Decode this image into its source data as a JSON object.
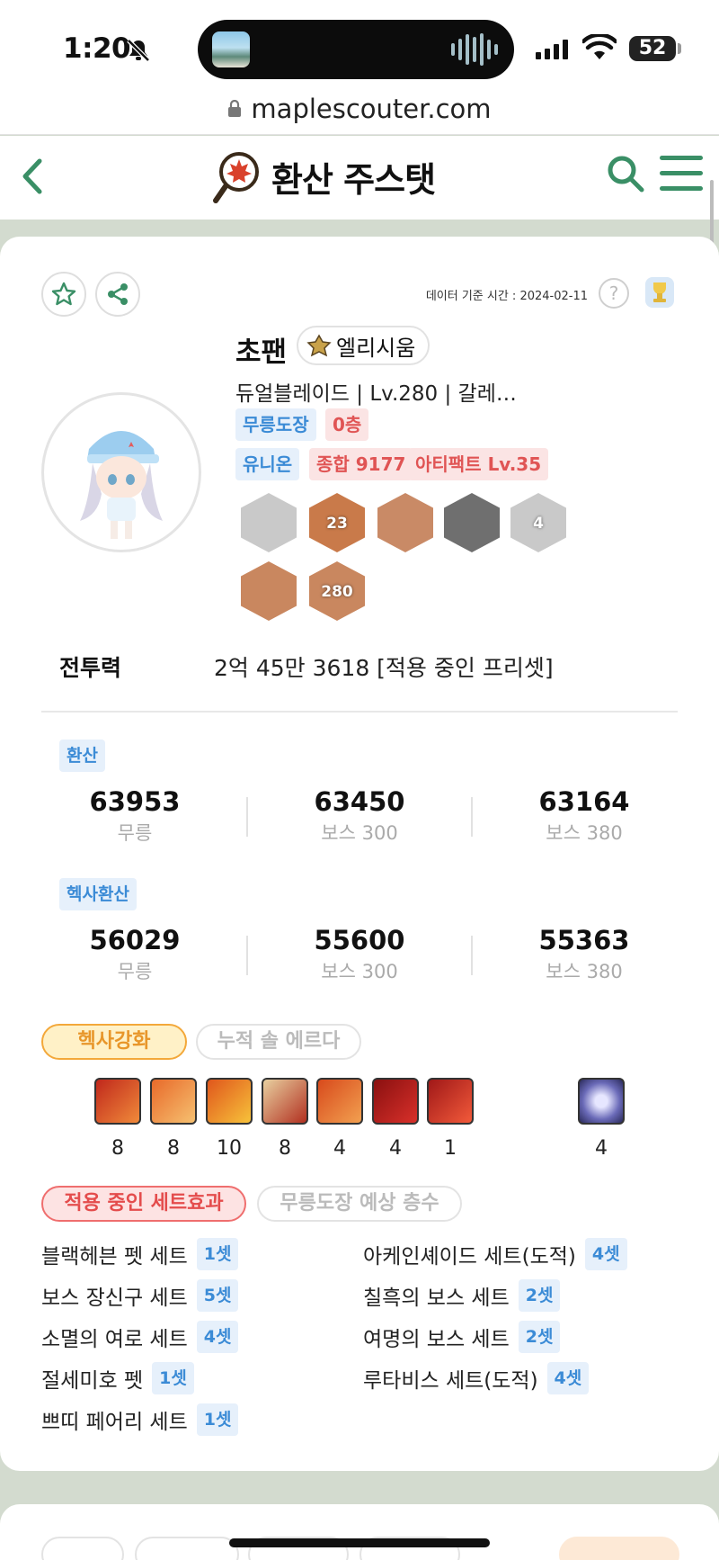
{
  "status_bar": {
    "time": "1:20",
    "battery": "52"
  },
  "browser": {
    "url": "maplescouter.com"
  },
  "nav": {
    "title": "환산 주스탯"
  },
  "profile": {
    "data_time": "데이터 기준 시간 : 2024-02-11",
    "help": "?",
    "name": "초팬",
    "server": "엘리시움",
    "sub_info": "듀얼블레이드 | Lv.280 | 갈레…",
    "tags_row1": [
      "무릉도장",
      "0층"
    ],
    "tags_row2": [
      "유니온",
      "종합 9177",
      "아티팩트 Lv.35"
    ],
    "badges": [
      {
        "name": "trophy-badge",
        "text": "",
        "color": "#c9c9c9"
      },
      {
        "name": "star-23-badge",
        "text": "23",
        "color": "#c97a4a"
      },
      {
        "name": "swords-badge",
        "text": "",
        "color": "#c98a66"
      },
      {
        "name": "skull-badge",
        "text": "",
        "color": "#6f6f6f"
      },
      {
        "name": "witch-hat-4-badge",
        "text": "4",
        "color": "#c9c9c9"
      },
      {
        "name": "hand-badge",
        "text": "",
        "color": "#c9875f"
      },
      {
        "name": "level-280-badge",
        "text": "280",
        "color": "#c9875f"
      }
    ]
  },
  "combat_power": {
    "label": "전투력",
    "value": "2억 45만 3618   [적용 중인 프리셋]"
  },
  "hwansan": {
    "label": "환산",
    "stats": [
      {
        "value": "63953",
        "label": "무릉"
      },
      {
        "value": "63450",
        "label": "보스 300"
      },
      {
        "value": "63164",
        "label": "보스 380"
      }
    ]
  },
  "hexa_hwansan": {
    "label": "헥사환산",
    "stats": [
      {
        "value": "56029",
        "label": "무릉"
      },
      {
        "value": "55600",
        "label": "보스 300"
      },
      {
        "value": "55363",
        "label": "보스 380"
      }
    ]
  },
  "hexa_tabs": {
    "active": "헥사강화",
    "inactive": "누적 솔 에르다"
  },
  "skills": {
    "levels": [
      "8",
      "8",
      "10",
      "8",
      "4",
      "4",
      "1"
    ],
    "extra_level": "4"
  },
  "set_tabs": {
    "active": "적용 중인 세트효과",
    "inactive": "무릉도장 예상 층수"
  },
  "sets_left": [
    {
      "name": "블랙헤븐 펫 세트",
      "count": "1셋"
    },
    {
      "name": "보스 장신구 세트",
      "count": "5셋"
    },
    {
      "name": "소멸의 여로 세트",
      "count": "4셋"
    },
    {
      "name": "절세미호 펫",
      "count": "1셋"
    },
    {
      "name": "쁘띠 페어리 세트",
      "count": "1셋"
    }
  ],
  "sets_right": [
    {
      "name": "아케인셰이드 세트(도적)",
      "count": "4셋"
    },
    {
      "name": "칠흑의 보스 세트",
      "count": "2셋"
    },
    {
      "name": "여명의 보스 세트",
      "count": "2셋"
    },
    {
      "name": "루타비스 세트(도적)",
      "count": "4셋"
    }
  ],
  "colors": {
    "accent": "#3a8f66",
    "tag_blue": "#3b8bd6",
    "tag_red": "#e05454",
    "bg": "#d3dbcf"
  }
}
